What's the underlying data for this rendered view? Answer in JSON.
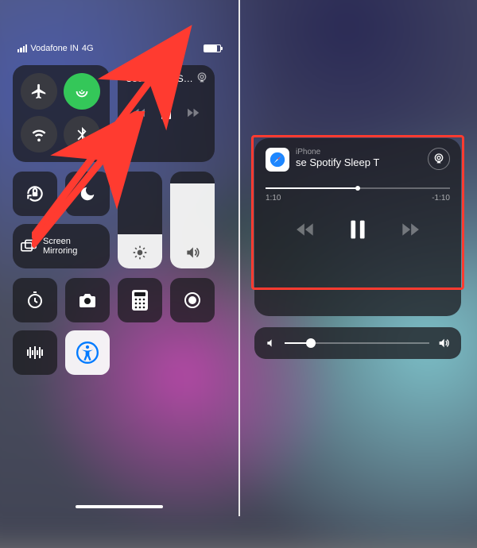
{
  "status": {
    "carrier": "Vodafone IN",
    "network": "4G",
    "battery_pct": 80
  },
  "connectivity": {
    "airplane": "airplane-icon",
    "cellular": "cellular-icon",
    "wifi": "wifi-icon",
    "bluetooth": "bluetooth-icon"
  },
  "media_mini": {
    "title": "Use Spotify S…",
    "rewind": "rewind-icon",
    "play_pause": "pause-icon",
    "forward": "forward-icon",
    "airplay": "airplay-icon"
  },
  "tiles": {
    "orientation_lock": "orientation-lock-icon",
    "dnd": "moon-icon",
    "mirroring_label": "Screen Mirroring",
    "brightness": "brightness-icon",
    "volume": "volume-icon",
    "timer": "timer-icon",
    "camera": "camera-icon",
    "calculator": "calculator-icon",
    "record": "record-icon",
    "voice_memo": "waveform-icon",
    "accessibility": "accessibility-icon"
  },
  "media_expanded": {
    "source": "iPhone",
    "title": "se Spotify Sleep T",
    "elapsed": "1:10",
    "remaining": "-1:10",
    "progress_pct": 50,
    "app": "safari-icon",
    "airplay": "airplay-icon",
    "rewind": "rewind-icon",
    "play_pause": "pause-icon",
    "forward": "forward-icon",
    "vol_low": "volume-low-icon",
    "vol_high": "volume-high-icon",
    "volume_pct": 18
  },
  "annotations": {
    "highlight_color": "#ff3b30",
    "arrow_color": "#ff3b30"
  }
}
